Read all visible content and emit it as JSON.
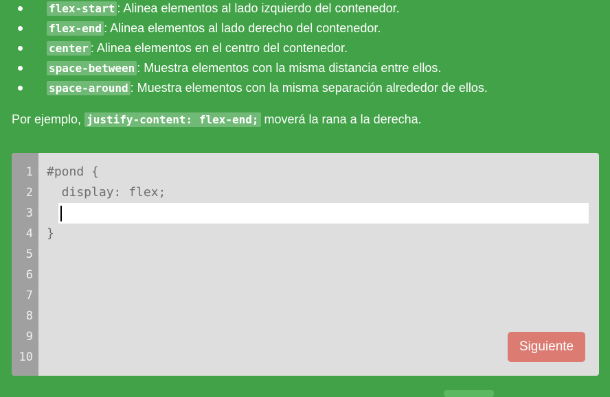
{
  "instructions": {
    "values": [
      {
        "keyword": "flex-start",
        "description": ": Alinea elementos al lado izquierdo del contenedor."
      },
      {
        "keyword": "flex-end",
        "description": ": Alinea elementos al lado derecho del contenedor."
      },
      {
        "keyword": "center",
        "description": ": Alinea elementos en el centro del contenedor."
      },
      {
        "keyword": "space-between",
        "description": ": Muestra elementos con la misma distancia entre ellos."
      },
      {
        "keyword": "space-around",
        "description": ": Muestra elementos con la misma separación alrededor de ellos."
      }
    ],
    "example": {
      "prefix": "Por ejemplo, ",
      "code": "justify-content: flex-end;",
      "suffix": " moverá la rana a la derecha."
    }
  },
  "editor": {
    "line_numbers": [
      "1",
      "2",
      "3",
      "4",
      "5",
      "6",
      "7",
      "8",
      "9",
      "10"
    ],
    "code_lines": {
      "l1": "#pond {",
      "l2": "  display: flex;",
      "l4": "}"
    },
    "answer_value": "",
    "next_button_label": "Siguiente"
  },
  "colors": {
    "page_background": "#42a248",
    "editor_background": "#dedede",
    "gutter_background": "#a0a0a0",
    "next_button": "#db7b72"
  }
}
